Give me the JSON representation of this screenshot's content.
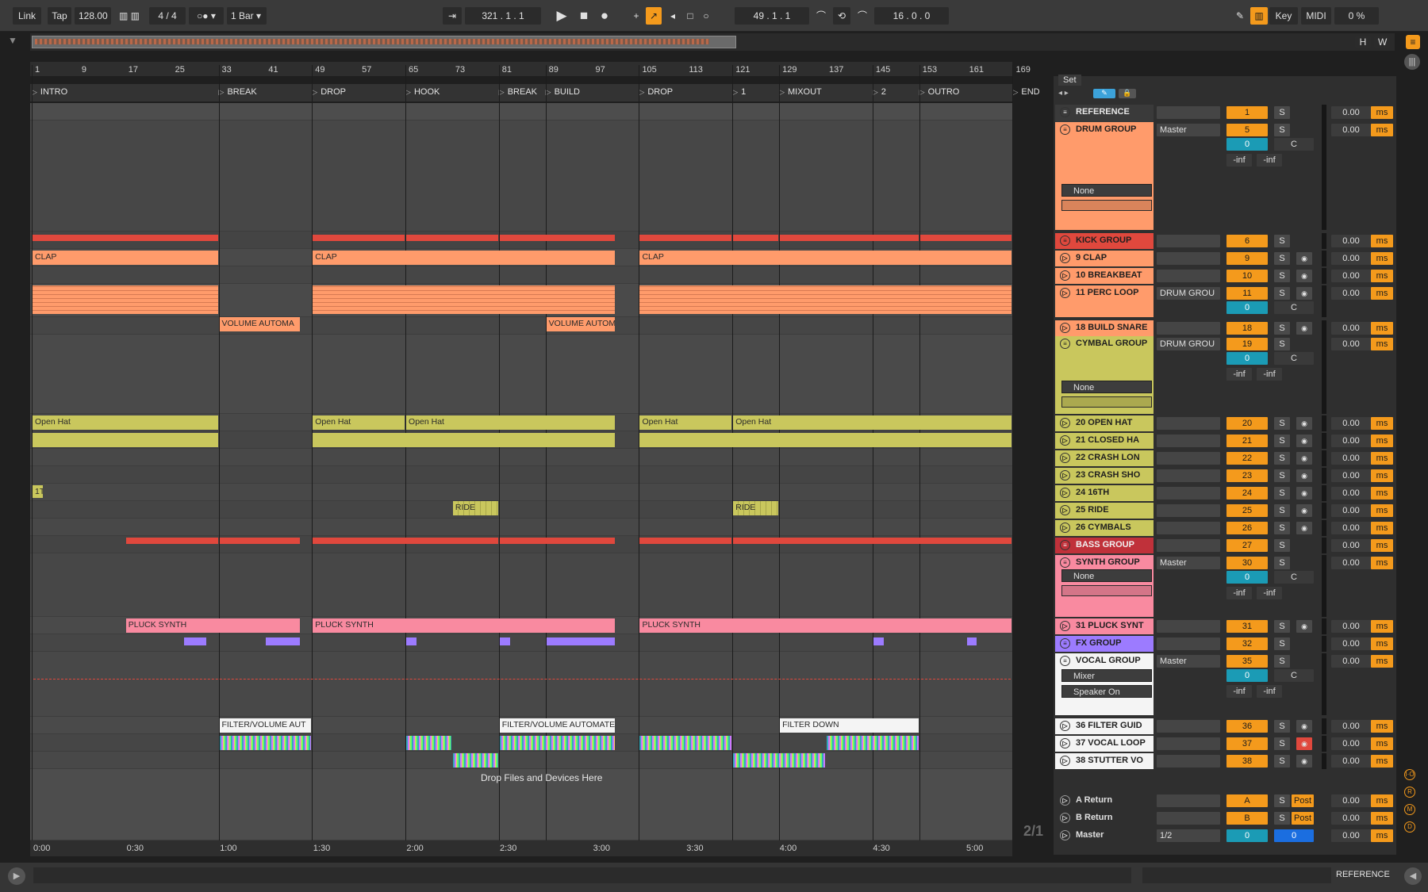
{
  "transport": {
    "link": "Link",
    "tap": "Tap",
    "tempo": "128.00",
    "signature": "4 / 4",
    "quantize": "1 Bar",
    "arrangement_position": "321 .  1 .  1",
    "loop_start": "49 .  1 .  1",
    "loop_length": "16 .  0 .  0",
    "key": "Key",
    "midi": "MIDI",
    "cpu": "0 %"
  },
  "overview": {
    "h": "H",
    "w": "W"
  },
  "ruler": {
    "bars": [
      "1",
      "9",
      "17",
      "25",
      "33",
      "41",
      "49",
      "57",
      "65",
      "73",
      "81",
      "89",
      "97",
      "105",
      "113",
      "121",
      "129",
      "137",
      "145",
      "153",
      "161",
      "169"
    ]
  },
  "locators": [
    "INTRO",
    "BREAK",
    "DROP",
    "HOOK",
    "BREAK",
    "BUILD",
    "DROP",
    "1",
    "MIXOUT",
    "2",
    "OUTRO",
    "END"
  ],
  "time_ruler": [
    "0:00",
    "0:30",
    "1:00",
    "1:30",
    "2:00",
    "2:30",
    "3:00",
    "3:30",
    "4:00",
    "4:30",
    "5:00"
  ],
  "clips": {
    "clap": "CLAP",
    "volume_automation": "VOLUME AUTOMA",
    "open_hat": "Open Hat",
    "ride": "RIDE",
    "pluck": "PLUCK SYNTH",
    "filter_volume": "FILTER/VOLUME AUT",
    "filter_volume_2": "FILTER/VOLUME AUTOMATE",
    "filter_down": "FILTER DOWN",
    "one_t": "1T",
    "drop_hint": "Drop Files and Devices Here",
    "page_indicator": "2/1"
  },
  "mixer": {
    "set_label": "Set",
    "none": "None",
    "master": "Master",
    "drum_group_route": "DRUM GROU",
    "mixer_label": "Mixer",
    "speaker_on": "Speaker On",
    "inf": "-inf",
    "c": "C",
    "zero": "0",
    "solo": "S",
    "post": "Post",
    "db": "0.00",
    "ms": "ms",
    "tracks": [
      {
        "name": "REFERENCE",
        "num": "1"
      },
      {
        "name": "DRUM GROUP",
        "num": "5"
      },
      {
        "name": "KICK GROUP",
        "num": "6"
      },
      {
        "name": "9 CLAP",
        "num": "9"
      },
      {
        "name": "10 BREAKBEAT",
        "num": "10"
      },
      {
        "name": "11 PERC LOOP",
        "num": "11"
      },
      {
        "name": "18 BUILD SNARE",
        "num": "18"
      },
      {
        "name": "CYMBAL GROUP",
        "num": "19"
      },
      {
        "name": "20 OPEN HAT",
        "num": "20"
      },
      {
        "name": "21 CLOSED HA",
        "num": "21"
      },
      {
        "name": "22 CRASH LON",
        "num": "22"
      },
      {
        "name": "23 CRASH SHO",
        "num": "23"
      },
      {
        "name": "24 16TH",
        "num": "24"
      },
      {
        "name": "25 RIDE",
        "num": "25"
      },
      {
        "name": "26 CYMBALS",
        "num": "26"
      },
      {
        "name": "BASS GROUP",
        "num": "27"
      },
      {
        "name": "SYNTH GROUP",
        "num": "30"
      },
      {
        "name": "31 PLUCK SYNT",
        "num": "31"
      },
      {
        "name": "FX GROUP",
        "num": "32"
      },
      {
        "name": "VOCAL GROUP",
        "num": "35"
      },
      {
        "name": "36 FILTER GUID",
        "num": "36"
      },
      {
        "name": "37 VOCAL LOOP",
        "num": "37"
      },
      {
        "name": "38 STUTTER VO",
        "num": "38"
      }
    ],
    "returns": [
      {
        "name": "A Return",
        "num": "A"
      },
      {
        "name": "B Return",
        "num": "B"
      },
      {
        "name": "Master",
        "num": "0"
      }
    ],
    "master_route": "1/2",
    "master_second": "0"
  },
  "status": {
    "selected_track": "REFERENCE"
  },
  "colors": {
    "orange": "#f49a1c",
    "salmon": "#ff9b6b",
    "red": "#e0483d",
    "yellow": "#c9c75d",
    "pink": "#f98aa0",
    "purple": "#9c7bff"
  }
}
